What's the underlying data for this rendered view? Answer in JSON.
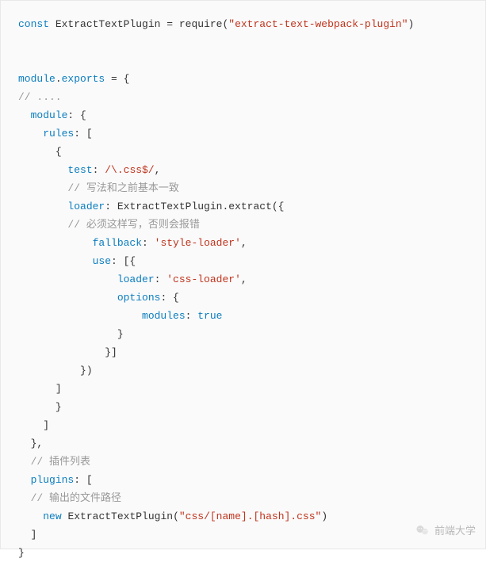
{
  "colors": {
    "bg": "#fafafa",
    "border": "#e8e8e8",
    "text": "#333333",
    "keyword": "#0b7dbf",
    "string": "#c0341d",
    "comment": "#999999",
    "watermark": "#b9b9b9"
  },
  "watermark": {
    "icon": "wechat-icon",
    "text": "前端大学"
  },
  "code": {
    "lines": [
      {
        "indent": 0,
        "tokens": [
          {
            "t": "kw",
            "v": "const "
          },
          {
            "t": "ident",
            "v": "ExtractTextPlugin "
          },
          {
            "t": "paren",
            "v": "= "
          },
          {
            "t": "fn",
            "v": "require"
          },
          {
            "t": "paren",
            "v": "("
          },
          {
            "t": "str",
            "v": "\"extract-text-webpack-plugin\""
          },
          {
            "t": "paren",
            "v": ")"
          }
        ]
      },
      {
        "indent": 0,
        "tokens": []
      },
      {
        "indent": 0,
        "tokens": []
      },
      {
        "indent": 0,
        "tokens": [
          {
            "t": "prop",
            "v": "module"
          },
          {
            "t": "dot",
            "v": "."
          },
          {
            "t": "prop",
            "v": "exports"
          },
          {
            "t": "plain",
            "v": " = {"
          }
        ]
      },
      {
        "indent": 0,
        "tokens": [
          {
            "t": "cmt",
            "v": "// ...."
          }
        ]
      },
      {
        "indent": 2,
        "tokens": [
          {
            "t": "prop",
            "v": "module"
          },
          {
            "t": "plain",
            "v": ": {"
          }
        ]
      },
      {
        "indent": 4,
        "tokens": [
          {
            "t": "prop",
            "v": "rules"
          },
          {
            "t": "plain",
            "v": ": ["
          }
        ]
      },
      {
        "indent": 6,
        "tokens": [
          {
            "t": "plain",
            "v": "{"
          }
        ]
      },
      {
        "indent": 8,
        "tokens": [
          {
            "t": "prop",
            "v": "test"
          },
          {
            "t": "plain",
            "v": ": "
          },
          {
            "t": "regex",
            "v": "/\\.css$/"
          },
          {
            "t": "plain",
            "v": ","
          }
        ]
      },
      {
        "indent": 8,
        "tokens": [
          {
            "t": "cmt",
            "v": "// 写法和之前基本一致"
          }
        ]
      },
      {
        "indent": 8,
        "tokens": [
          {
            "t": "prop",
            "v": "loader"
          },
          {
            "t": "plain",
            "v": ": ExtractTextPlugin.extract({"
          }
        ]
      },
      {
        "indent": 8,
        "tokens": [
          {
            "t": "cmt",
            "v": "// 必须这样写，否则会报错"
          }
        ]
      },
      {
        "indent": 12,
        "tokens": [
          {
            "t": "prop",
            "v": "fallback"
          },
          {
            "t": "plain",
            "v": ": "
          },
          {
            "t": "str",
            "v": "'style-loader'"
          },
          {
            "t": "plain",
            "v": ","
          }
        ]
      },
      {
        "indent": 12,
        "tokens": [
          {
            "t": "prop",
            "v": "use"
          },
          {
            "t": "plain",
            "v": ": [{"
          }
        ]
      },
      {
        "indent": 16,
        "tokens": [
          {
            "t": "prop",
            "v": "loader"
          },
          {
            "t": "plain",
            "v": ": "
          },
          {
            "t": "str",
            "v": "'css-loader'"
          },
          {
            "t": "plain",
            "v": ","
          }
        ]
      },
      {
        "indent": 16,
        "tokens": [
          {
            "t": "prop",
            "v": "options"
          },
          {
            "t": "plain",
            "v": ": {"
          }
        ]
      },
      {
        "indent": 20,
        "tokens": [
          {
            "t": "prop",
            "v": "modules"
          },
          {
            "t": "plain",
            "v": ": "
          },
          {
            "t": "bool",
            "v": "true"
          }
        ]
      },
      {
        "indent": 16,
        "tokens": [
          {
            "t": "plain",
            "v": "}"
          }
        ]
      },
      {
        "indent": 14,
        "tokens": [
          {
            "t": "plain",
            "v": "}]"
          }
        ]
      },
      {
        "indent": 10,
        "tokens": [
          {
            "t": "plain",
            "v": "})"
          }
        ]
      },
      {
        "indent": 6,
        "tokens": [
          {
            "t": "plain",
            "v": "]"
          }
        ]
      },
      {
        "indent": 6,
        "tokens": [
          {
            "t": "plain",
            "v": "}"
          }
        ]
      },
      {
        "indent": 4,
        "tokens": [
          {
            "t": "plain",
            "v": "]"
          }
        ]
      },
      {
        "indent": 2,
        "tokens": [
          {
            "t": "plain",
            "v": "},"
          }
        ]
      },
      {
        "indent": 2,
        "tokens": [
          {
            "t": "cmt",
            "v": "// 插件列表"
          }
        ]
      },
      {
        "indent": 2,
        "tokens": [
          {
            "t": "prop",
            "v": "plugins"
          },
          {
            "t": "plain",
            "v": ": ["
          }
        ]
      },
      {
        "indent": 2,
        "tokens": [
          {
            "t": "cmt",
            "v": "// 输出的文件路径"
          }
        ]
      },
      {
        "indent": 4,
        "tokens": [
          {
            "t": "kw",
            "v": "new "
          },
          {
            "t": "ident",
            "v": "ExtractTextPlugin"
          },
          {
            "t": "paren",
            "v": "("
          },
          {
            "t": "str",
            "v": "\"css/[name].[hash].css\""
          },
          {
            "t": "paren",
            "v": ")"
          }
        ]
      },
      {
        "indent": 2,
        "tokens": [
          {
            "t": "plain",
            "v": "]"
          }
        ]
      },
      {
        "indent": 0,
        "tokens": [
          {
            "t": "plain",
            "v": "}"
          }
        ]
      }
    ]
  }
}
